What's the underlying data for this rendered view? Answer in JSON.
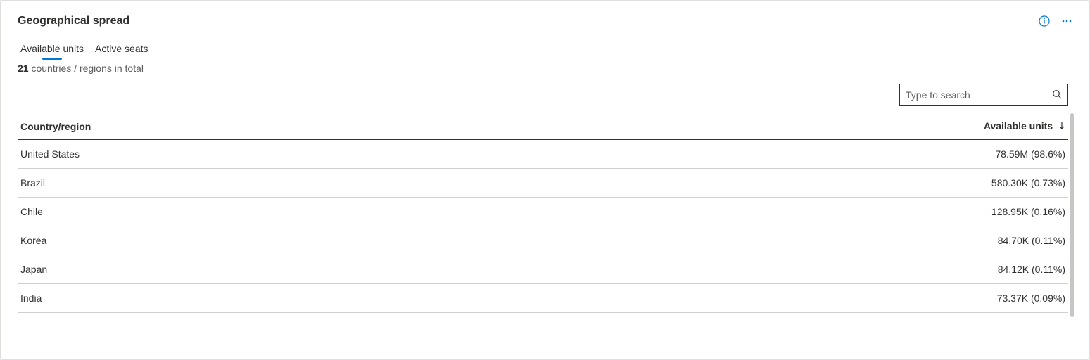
{
  "header": {
    "title": "Geographical spread"
  },
  "tabs": [
    {
      "label": "Available units",
      "selected": true
    },
    {
      "label": "Active seats",
      "selected": false
    }
  ],
  "summary": {
    "count": "21",
    "suffix": " countries / regions in total"
  },
  "search": {
    "placeholder": "Type to search",
    "value": ""
  },
  "columns": {
    "country": "Country/region",
    "value": "Available units",
    "sort": "desc"
  },
  "rows": [
    {
      "country": "United States",
      "value": "78.59M (98.6%)"
    },
    {
      "country": "Brazil",
      "value": "580.30K (0.73%)"
    },
    {
      "country": "Chile",
      "value": "128.95K (0.16%)"
    },
    {
      "country": "Korea",
      "value": "84.70K (0.11%)"
    },
    {
      "country": "Japan",
      "value": "84.12K (0.11%)"
    },
    {
      "country": "India",
      "value": "73.37K (0.09%)"
    }
  ]
}
